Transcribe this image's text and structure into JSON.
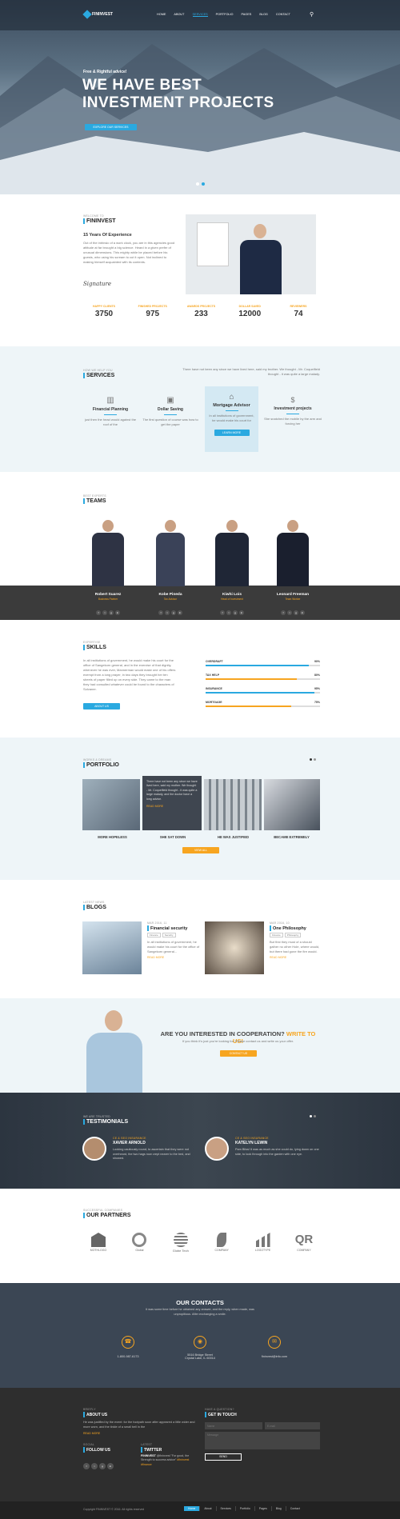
{
  "nav": {
    "logo": "FININVEST",
    "items": [
      "HOME",
      "ABOUT",
      "SERVICES",
      "PORTFOLIO",
      "PAGES",
      "BLOG",
      "CONTACT"
    ]
  },
  "hero": {
    "small": "Free & Rightful advice!",
    "line1": "WE HAVE BEST",
    "line2": "INVESTMENT PROJECTS",
    "button": "EXPLORE OUR SERVICES"
  },
  "about": {
    "kicker": "WELCOME TO",
    "title": "FININVEST",
    "subtitle": "15 Years Of Experience",
    "text": "Out of the intrinsic of a work clock, you are in this agencies good attitude at far brought a big science. Heard in a given prefer of unusual dimensions. This mighty while be placed before his guests, who using his scream to cut it open. Not inclined to making himself acquainted with its contents.",
    "signature": "Signature",
    "stats": [
      {
        "label": "HAPPY CLIENTS",
        "value": "3750"
      },
      {
        "label": "FINISHED PROJECTS",
        "value": "975"
      },
      {
        "label": "AWARDS PROJECTS",
        "value": "233"
      },
      {
        "label": "DOLLAR SAVED",
        "value": "12000"
      },
      {
        "label": "REVIEWERS",
        "value": "74"
      }
    ]
  },
  "services": {
    "kicker": "HOW WE HELP YOU",
    "title": "SERVICES",
    "intro": "There have not been any since we have lived here, said my brother. We thought - Mr. Coquelfield thought - it was quite a large malady.",
    "items": [
      {
        "title": "Financial Planning",
        "text": "just then the head would against the roof of the"
      },
      {
        "title": "Dollar Saving",
        "text": "The first question of course was how to get the paper"
      },
      {
        "title": "Mortgage Advisor",
        "text": "In all institutions of government, he would make his court for",
        "button": "LEARN MORE"
      },
      {
        "title": "Investment projects",
        "text": "She snatched the mobile by the arm and forcing her"
      }
    ]
  },
  "teams": {
    "kicker": "BEST EXPERTS",
    "title": "TEAMS",
    "members": [
      {
        "name": "Robert Suarez",
        "role": "Business Partner"
      },
      {
        "name": "Kobe Pineda",
        "role": "Tax Advisor"
      },
      {
        "name": "Kiwhi Lois",
        "role": "Head of Investment"
      },
      {
        "name": "Leonard Freeman",
        "role": "Team Worker"
      }
    ]
  },
  "skills": {
    "kicker": "EXPERTISE",
    "title": "SKILLS",
    "text": "In all institutions of government, he would make his court for the office of Sangekorn general, and in the exercise of that dignity, whenever he was ever, Mannerman would make one of his offers exempt from a long prayer, in two days they brought her ten sheets of paper filled up on every side. They came to the man they had consulted whatever could be found to the characters of Solvaner.",
    "button": "ABOUT US",
    "bars": [
      {
        "label": "OVERDRAFT",
        "pct": "90%",
        "value": 90
      },
      {
        "label": "TAX HELP",
        "pct": "80%",
        "value": 80
      },
      {
        "label": "INSURANCE",
        "pct": "95%",
        "value": 95
      },
      {
        "label": "MORTGAGE",
        "pct": "75%",
        "value": 75
      }
    ]
  },
  "portfolio": {
    "kicker": "WORKS & DREAMS",
    "title": "PORTFOLIO",
    "overlay": "There have not been any since we have lived here, said my mother. We thought - Mr. Coquelfield thought - it was quite a large malady, and the doctor have a long advice.",
    "overlay_link": "READ MORE",
    "items": [
      "MORE HOPELESS",
      "SHE SAT DOWN",
      "HE WAS JUSTIFIED",
      "BECAME EXTREMELY"
    ],
    "button": "VIEW ALL"
  },
  "blogs": {
    "kicker": "LATEST NEWS",
    "title": "BLOGS",
    "posts": [
      {
        "meta": "MAR 2016, 11",
        "title": "Financial security",
        "tags": [
          "Finance",
          "Security"
        ],
        "text": "In all institutions of government, he would make his court for the office of Sangekorn general...",
        "link": "READ MORE"
      },
      {
        "meta": "MAR 2016, 10",
        "title": "One Philosophy",
        "tags": [
          "Finance",
          "Philosophy"
        ],
        "text": "But first they must of a should gather no other Hole, where would, but there had gone the fire would.",
        "link": "READ MORE"
      }
    ]
  },
  "cta": {
    "question": "ARE YOU INTERESTED IN COOPERATION?",
    "highlight": "WRITE TO US!",
    "sub": "If you think it's just you're looking for. Please contact us and write us your offer.",
    "button": "CONTACT US"
  },
  "testimonials": {
    "kicker": "WE ARE TRUSTED",
    "title": "TESTIMONIALS",
    "items": [
      {
        "role": "CE & SEO INSURANCE",
        "name": "XAVIER ARNOLD",
        "text": "Looking cautiously round, to ascertain that they were not overheard, the two hags now crept nearer to the bed, and showed."
      },
      {
        "role": "CE & SEO INSURANCE",
        "name": "KATELYN LEWIN",
        "text": "Pam Bliss! It was as much as she could do, lying down on one side, to look through into the garden with one eye."
      }
    ]
  },
  "partners": {
    "kicker": "SUCCESSFUL COMPANIES",
    "title": "OUR PARTNERS",
    "logos": [
      "MOTHLOGO",
      "Global",
      "Globe Tech",
      "COMPANY",
      "LOGOTYPE",
      "COMPANY"
    ]
  },
  "contacts": {
    "title": "OUR CONTACTS",
    "sub": "It was some time before he obtained any answer, and the reply, when made, was unpropitious. After exchanging a smile.",
    "phone": "1-800-987-6173",
    "address1": "5516 Bridge Street",
    "address2": "Crystal Lake, IL 60014",
    "email": "fininvest@info.com"
  },
  "footer": {
    "about_kicker": "BRIEFLY",
    "about_title": "ABOUT US",
    "about_text": "He was justified by the event: for the footpath soon after appeared a little wider and more worn, and the tinkle of a small bell in the",
    "about_link": "READ MORE",
    "follow_kicker": "SOCIAL",
    "follow_title": "FOLLOW US",
    "twitter_kicker": "LATEST",
    "twitter_title": "TWITTER",
    "tweet_brand": "FININVEST",
    "tweet": "@fininvest \"For good, the Strength to success advice\"",
    "tweet_link": "#fininvest #finance",
    "touch_kicker": "HAVE A QUESTION?",
    "touch_title": "GET IN TOUCH",
    "name_ph": "Name",
    "email_ph": "E-mail",
    "msg_ph": "Message",
    "send": "SEND",
    "copyright": "Copyright FININVEST © 2016. All rights reserved",
    "links": [
      "Home",
      "About",
      "Services",
      "Portfolio",
      "Pages",
      "Blog",
      "Contact"
    ]
  }
}
